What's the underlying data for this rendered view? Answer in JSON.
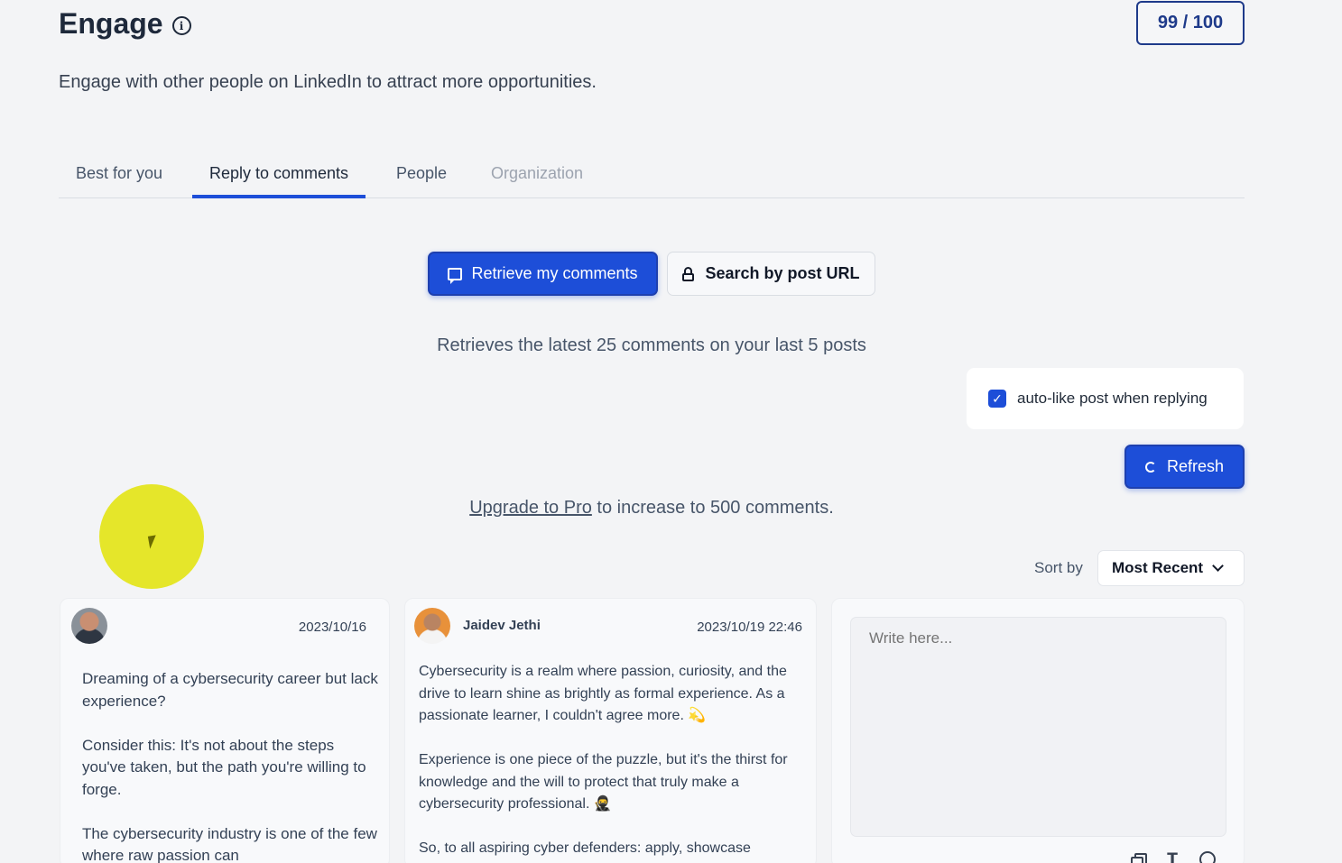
{
  "header": {
    "title": "Engage",
    "info_icon": "i",
    "score": "99 / 100",
    "subtitle": "Engage with other people on LinkedIn to attract more opportunities."
  },
  "tabs": [
    {
      "label": "Best for you",
      "state": "default"
    },
    {
      "label": "Reply to comments",
      "state": "active"
    },
    {
      "label": "People",
      "state": "default"
    },
    {
      "label": "Organization",
      "state": "disabled"
    }
  ],
  "actions": {
    "retrieve_label": "Retrieve my comments",
    "retrieve_icon": "chat-icon",
    "search_label": "Search by post URL",
    "search_icon": "lock-icon",
    "retrieve_info": "Retrieves the latest 25 comments on your last 5 posts"
  },
  "auto_like": {
    "label": "auto-like post when replying",
    "checked": true,
    "check_glyph": "✓"
  },
  "refresh": {
    "label": "Refresh",
    "icon": "refresh-icon"
  },
  "upgrade": {
    "link": "Upgrade to Pro",
    "rest": " to increase to 500 comments."
  },
  "sort": {
    "label": "Sort by",
    "selected": "Most Recent"
  },
  "comments": [
    {
      "author": "",
      "date": "2023/10/16",
      "paragraphs": [
        "Dreaming of a cybersecurity career but lack experience?",
        "Consider this: It's not about the steps you've taken, but the path you're willing to forge.",
        "The cybersecurity industry is one of the few where raw passion can"
      ]
    },
    {
      "author": "Jaidev Jethi",
      "date": "2023/10/19 22:46",
      "paragraphs": [
        "Cybersecurity is a realm where passion, curiosity, and the drive to learn shine as brightly as formal experience. As a passionate learner, I couldn't agree more. 💫",
        "Experience is one piece of the puzzle, but it's the thirst for knowledge and the will to protect that truly make a cybersecurity professional. 🥷",
        "So, to all aspiring cyber defenders: apply, showcase"
      ]
    }
  ],
  "reply": {
    "placeholder": "Write here...",
    "text_tool_glyph": "T"
  },
  "colors": {
    "accent": "#1d4ed8",
    "background": "#f3f4f6",
    "cursor_highlight": "#e5e62a"
  }
}
